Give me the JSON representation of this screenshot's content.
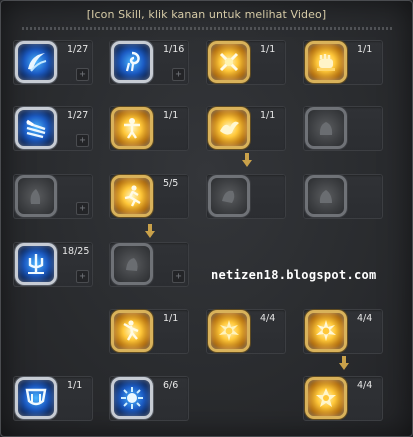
{
  "header": {
    "title": "[Icon Skill, klik kanan untuk melihat Video]"
  },
  "watermark": "netizen18.blogspot.com",
  "plus_glyph": "+",
  "colors": {
    "active_blue": "#1c5cc4",
    "active_gold": "#ffc83a",
    "locked_gray": "#3d3f42",
    "arrow": "#c9a14a"
  },
  "skills": {
    "r1c1": {
      "icon": "blue-crescent-slash-icon",
      "level": "1/27"
    },
    "r1c2": {
      "icon": "blue-spiral-icon",
      "level": "1/16"
    },
    "r1c3": {
      "icon": "gold-cross-strike-icon",
      "level": "1/1"
    },
    "r1c4": {
      "icon": "gold-fist-icon",
      "level": "1/1"
    },
    "r2c1": {
      "icon": "blue-triple-slash-icon",
      "level": "1/27"
    },
    "r2c2": {
      "icon": "gold-figure-icon",
      "level": "1/1"
    },
    "r2c3": {
      "icon": "gold-bird-icon",
      "level": "1/1"
    },
    "r2c4": {
      "icon": "gray-locked-icon",
      "level": ""
    },
    "r3c1": {
      "icon": "gray-locked-icon",
      "level": ""
    },
    "r3c2": {
      "icon": "gold-runner-icon",
      "level": "5/5"
    },
    "r3c3": {
      "icon": "gray-locked-icon",
      "level": ""
    },
    "r3c4": {
      "icon": "gray-locked-icon",
      "level": ""
    },
    "r4c1": {
      "icon": "blue-trident-icon",
      "level": "18/25"
    },
    "r4c2": {
      "icon": "gray-locked-icon",
      "level": ""
    },
    "r5c2": {
      "icon": "gold-dancer-icon",
      "level": "1/1"
    },
    "r5c3": {
      "icon": "gold-hp-burst-icon",
      "level": "4/4"
    },
    "r5c4": {
      "icon": "gold-mp-burst-icon",
      "level": "4/4"
    },
    "r6c1": {
      "icon": "blue-shield-icon",
      "level": "1/1"
    },
    "r6c2": {
      "icon": "blue-radiance-icon",
      "level": "6/6"
    },
    "r6c4": {
      "icon": "gold-mp-star-icon",
      "level": "4/4"
    }
  }
}
